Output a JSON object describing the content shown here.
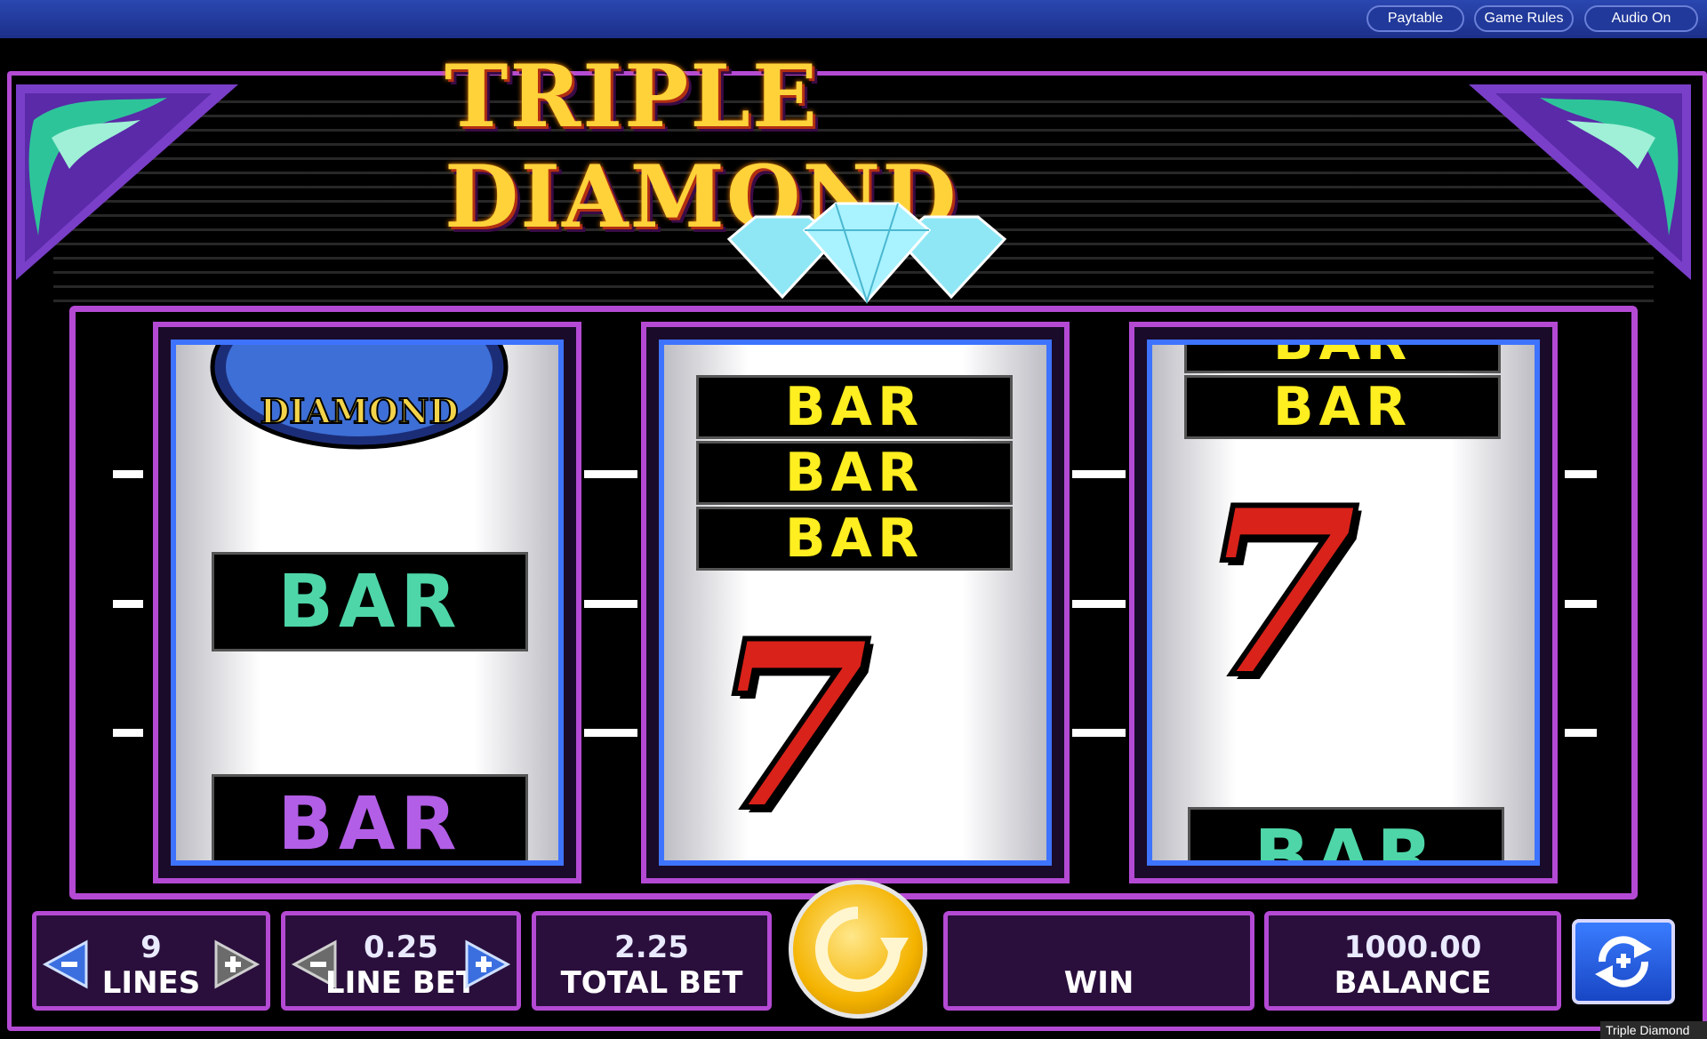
{
  "topbar": {
    "paytable": "Paytable",
    "game_rules": "Game Rules",
    "audio": "Audio On"
  },
  "game": {
    "title": "TRIPLE DIAMOND",
    "reel1_top_symbol": "DIAMOND"
  },
  "reels": {
    "reel1": [
      "DIAMOND",
      "BAR",
      "BAR"
    ],
    "reel2": [
      "BAR",
      "BAR",
      "BAR",
      "7"
    ],
    "reel3": [
      "BAR",
      "BAR",
      "7",
      "BAR"
    ]
  },
  "symbols": {
    "bar": "BAR",
    "seven": "7"
  },
  "controls": {
    "lines_value": "9",
    "lines_label": "LINES",
    "line_bet_value": "0.25",
    "line_bet_label": "LINE BET",
    "total_bet_value": "2.25",
    "total_bet_label": "TOTAL BET",
    "win_value": "",
    "win_label": "WIN",
    "balance_value": "1000.00",
    "balance_label": "BALANCE"
  },
  "tooltip": "Triple Diamond",
  "colors": {
    "frame": "#b44ad4",
    "reel_border": "#3e73ff",
    "bar_teal": "#4ed6a8",
    "bar_purple": "#b25ee6",
    "bar_yellow": "#ffee20",
    "seven_red": "#d9221a",
    "spin_gold": "#f4b300"
  }
}
